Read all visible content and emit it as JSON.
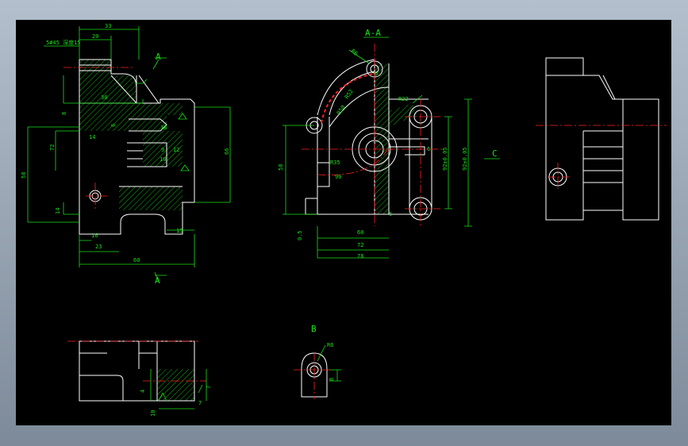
{
  "drawing": {
    "section_aa": "A-A",
    "section_b": "B",
    "view_c": "C",
    "view_a": "A"
  },
  "front_view_dims": [
    "33",
    "20",
    "5#45 深度15",
    "30",
    "18",
    "14",
    "14",
    "9",
    "8",
    "6",
    "72",
    "66",
    "58",
    "14",
    "16",
    "23",
    "60",
    "15",
    "18",
    "10",
    "12"
  ],
  "section_dims": [
    "6",
    "R22",
    "R52",
    "R50",
    "R35",
    "6",
    "90",
    "R20",
    "58",
    "60",
    "72",
    "78",
    "0.5",
    "92±0.05",
    "92±0.05"
  ],
  "section_b_dims": [
    "R6",
    "8"
  ],
  "bottom_view_dims": [
    "4",
    "7",
    "10"
  ],
  "colors": {
    "background": "#000000",
    "frame": "#8c99a8",
    "outline": "#ffffff",
    "dimension": "#19e019",
    "centerline": "#ff2020"
  }
}
